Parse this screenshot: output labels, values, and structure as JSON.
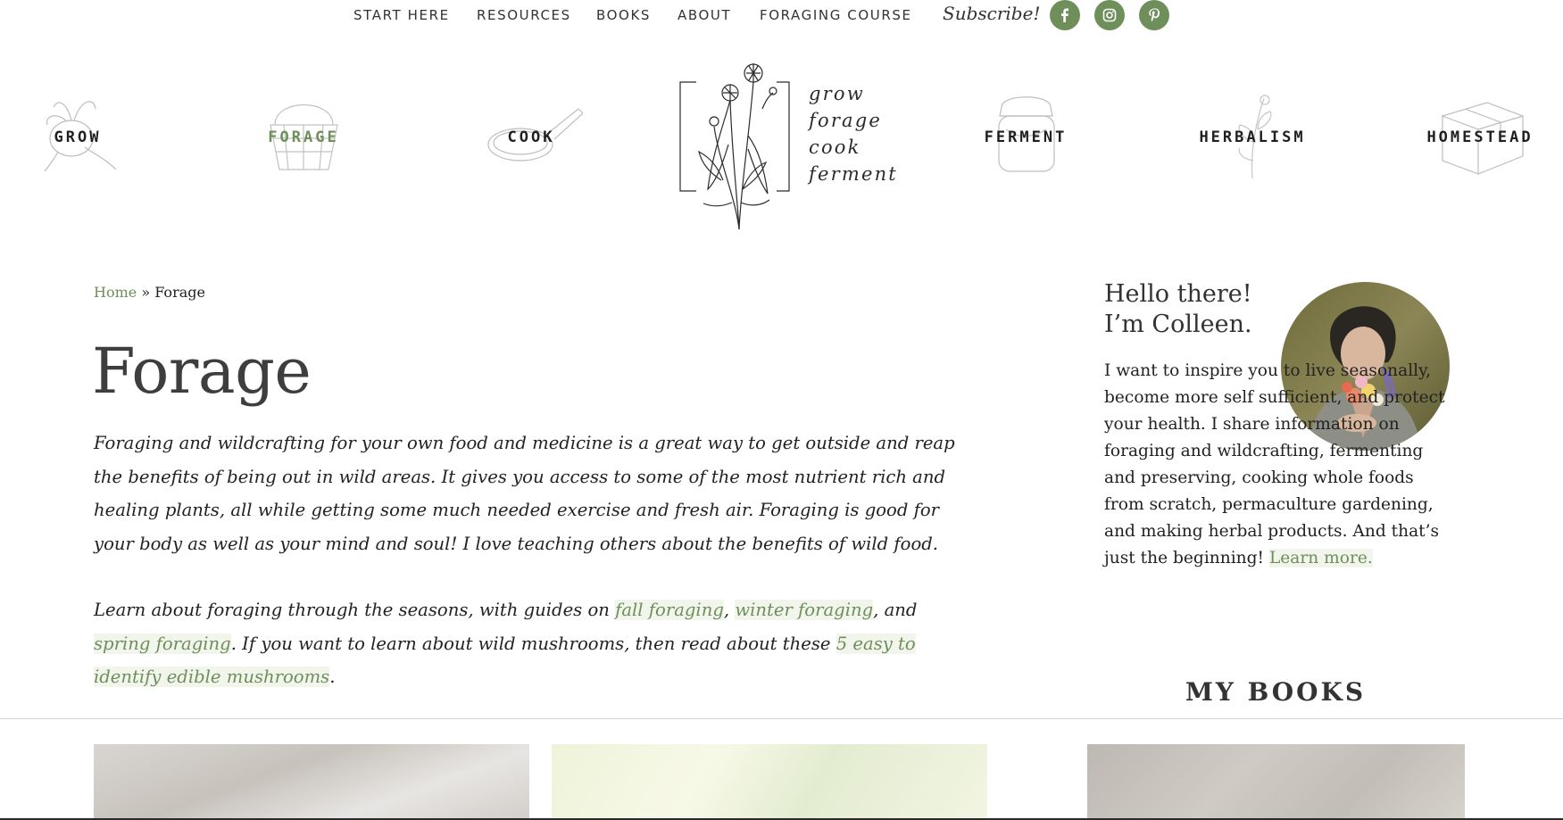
{
  "nav": {
    "links": [
      "START HERE",
      "RESOURCES",
      "BOOKS",
      "ABOUT",
      "FORAGING COURSE"
    ],
    "subscribe": "Subscribe!",
    "social": [
      "facebook-icon",
      "instagram-icon",
      "pinterest-icon"
    ]
  },
  "categories": [
    {
      "label": "GROW",
      "icon": "radish-icon"
    },
    {
      "label": "FORAGE",
      "icon": "basket-icon",
      "active": true
    },
    {
      "label": "COOK",
      "icon": "skillet-icon"
    },
    {
      "label": "FERMENT",
      "icon": "jar-icon"
    },
    {
      "label": "HERBALISM",
      "icon": "herb-icon"
    },
    {
      "label": "HOMESTEAD",
      "icon": "box-icon"
    }
  ],
  "logo": {
    "lines": [
      "grow",
      "forage",
      "cook",
      "ferment"
    ]
  },
  "breadcrumb": {
    "home": "Home",
    "sep": " » ",
    "current": "Forage"
  },
  "page": {
    "title": "Forage",
    "p1": "Foraging and wildcrafting for your own food and medicine is a great way to get outside and reap the benefits of being out in wild areas. It gives you access to some of the most nutrient rich and healing plants, all while getting some much needed exercise and fresh air. Foraging is good for your body as well as your mind and soul! I love teaching others about the benefits of wild food.",
    "p2": {
      "t1": "Learn about foraging through the seasons, with guides on ",
      "l1": "fall foraging",
      "t2": ", ",
      "l2": "winter foraging",
      "t3": ", and ",
      "l3": "spring foraging",
      "t4": ". If you want to learn about wild mushrooms, then read about these ",
      "l4": "5 easy to identify edible mushrooms",
      "t5": "."
    }
  },
  "sidebar": {
    "hello_line1": "Hello there!",
    "hello_line2": "I’m Colleen.",
    "intro": "I want to inspire you to live seasonally, become more self sufficient, and protect your health. I share information on foraging and wildcrafting, fermenting and preserving, cooking whole foods from scratch, permaculture gardening, and making herbal products. And that’s just the beginning! ",
    "learn_more": "Learn more.",
    "books_heading": "MY BOOKS"
  },
  "colors": {
    "accent": "#6e8f5a",
    "text": "#222222"
  }
}
